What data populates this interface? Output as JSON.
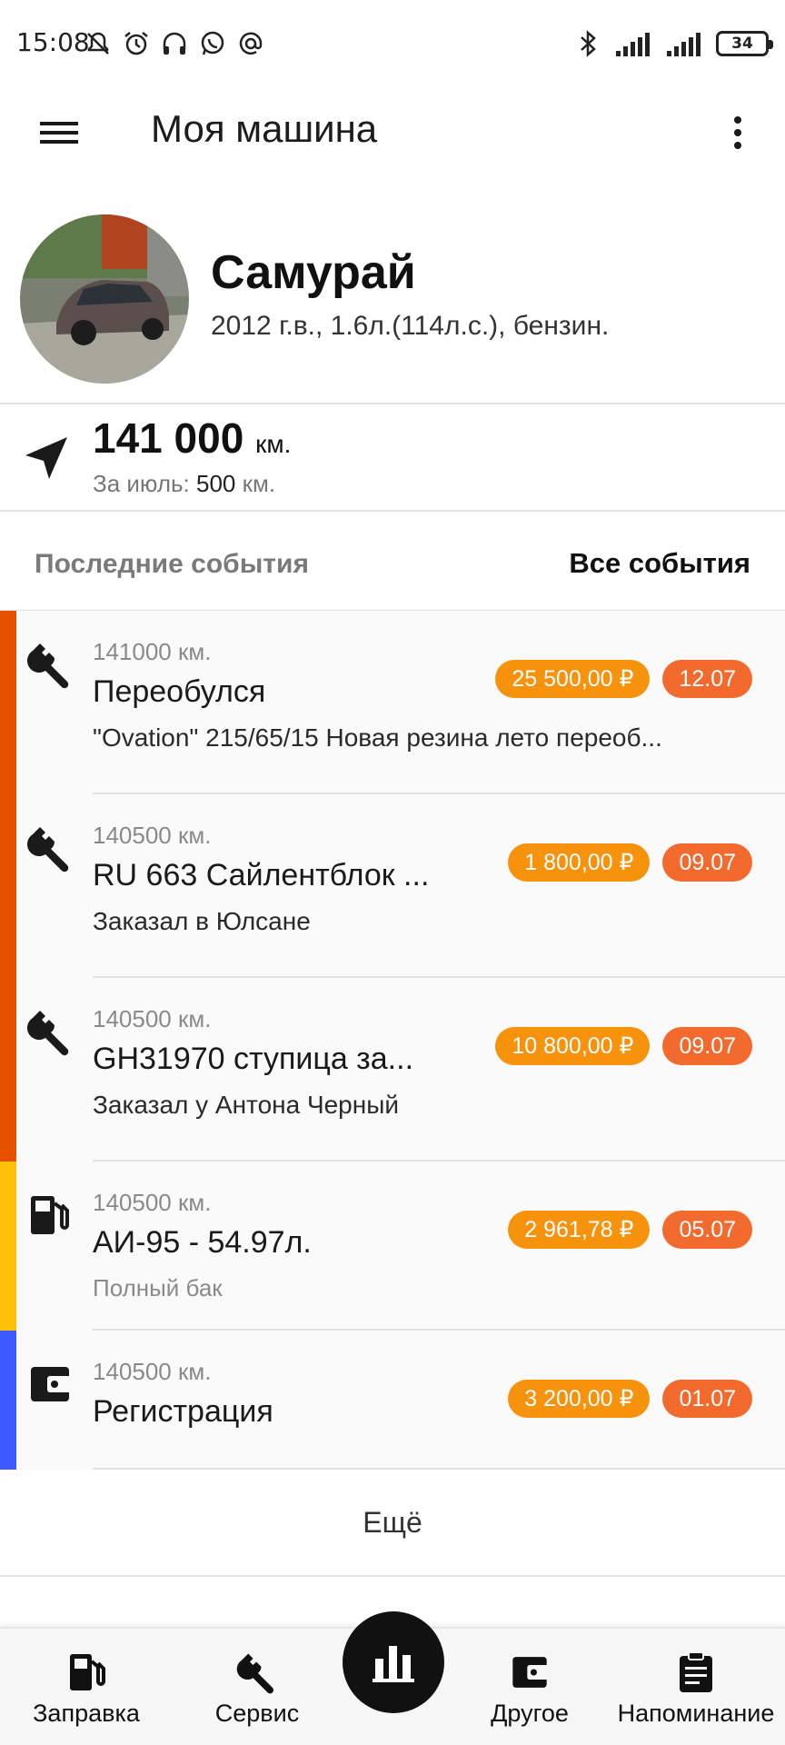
{
  "status_bar": {
    "time": "15:08",
    "battery": "34",
    "icons": [
      "mute-icon",
      "alarm-icon",
      "headset-icon",
      "whatsapp-icon",
      "at-icon",
      "bluetooth-icon",
      "signal-icon",
      "signal-icon"
    ]
  },
  "appbar": {
    "title": "Моя машина",
    "menu_icon": "hamburger-icon",
    "more_icon": "more-vert-icon"
  },
  "car": {
    "name": "Самурай",
    "spec": "2012 г.в., 1.6л.(114л.с.), бензин."
  },
  "mileage": {
    "value": "141 000",
    "unit": "км.",
    "month_label": "За июль:",
    "month_value": "500",
    "month_unit": "км."
  },
  "events_header": {
    "title": "Последние события",
    "all_link": "Все события"
  },
  "events": [
    {
      "km": "141000 км.",
      "name": "Переобулся",
      "desc": "\"Ovation\" 215/65/15 Новая резина лето переоб...",
      "price": "25 500,00 ₽",
      "date": "12.07",
      "icon": "wrench-icon",
      "color": "#e65100"
    },
    {
      "km": "140500 км.",
      "name": "RU 663 Сайлентблок ...",
      "desc": "Заказал в Юлсане",
      "price": "1 800,00 ₽",
      "date": "09.07",
      "icon": "wrench-icon",
      "color": "#e65100"
    },
    {
      "km": "140500 км.",
      "name": "GH31970 ступица за...",
      "desc": "Заказал у Антона Черный",
      "price": "10 800,00 ₽",
      "date": "09.07",
      "icon": "wrench-icon",
      "color": "#e65100"
    },
    {
      "km": "140500 км.",
      "name": "АИ-95 - 54.97л.",
      "desc": "Полный бак",
      "price": "2 961,78 ₽",
      "date": "05.07",
      "icon": "fuel-icon",
      "color": "#ffc107"
    },
    {
      "km": "140500 км.",
      "name": "Регистрация",
      "desc": "",
      "price": "3 200,00 ₽",
      "date": "01.07",
      "icon": "wallet-icon",
      "color": "#3d5afe"
    }
  ],
  "more_label": "Ещё",
  "bottom_nav": {
    "fuel": "Заправка",
    "service": "Сервис",
    "other": "Другое",
    "reminder": "Напоминание",
    "fab_icon": "bar-chart-icon"
  },
  "colors": {
    "price_badge": "#f6920c",
    "date_badge": "#f26a2e",
    "service": "#e65100",
    "fuel": "#ffc107",
    "other": "#3d5afe"
  }
}
